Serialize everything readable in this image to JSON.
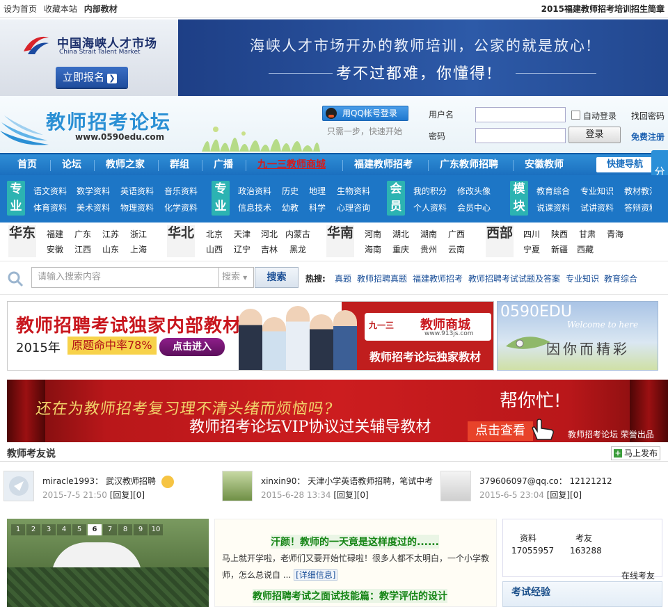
{
  "topbar": {
    "links": [
      "设为首页",
      "收藏本站"
    ],
    "bold_link": "内部教材",
    "right_link": "2015福建教师招考培训招生简章"
  },
  "banner": {
    "logo_cn": "中国海峡人才市场",
    "logo_en": "China Strait Talent Market",
    "register_btn": "立即报名",
    "slogan1": "海峡人才市场开办的教师培训，公家的就是放心!",
    "slogan2": "考不过都难，你懂得!"
  },
  "header": {
    "site_title": "教师招考论坛",
    "site_url": "www.0590edu.com",
    "qq_btn": "用QQ帐号登录",
    "qq_hint": "只需一步，快速开始",
    "username_label": "用户名",
    "password_label": "密码",
    "auto_login": "自动登录",
    "login_btn": "登录",
    "find_pwd": "找回密码",
    "register": "免费注册"
  },
  "nav": {
    "items": [
      "首页",
      "论坛",
      "教师之家",
      "群组",
      "广播",
      "九一三教师商城",
      "福建教师招考",
      "广东教师招聘",
      "安徽教师"
    ],
    "quick": "快捷导航",
    "share": "分享"
  },
  "categories": [
    {
      "badge": "专业",
      "links": [
        "语文资料",
        "数学资料",
        "英语资料",
        "音乐资料",
        "体育资料",
        "美术资料",
        "物理资料",
        "化学资料"
      ]
    },
    {
      "badge": "专业",
      "links": [
        "政治资料",
        "历史",
        "地理",
        "生物资料",
        "信息技术",
        "幼教",
        "科学",
        "心理咨询"
      ]
    },
    {
      "badge": "会员",
      "links": [
        "我的积分",
        "修改头像",
        "个人资料",
        "会员中心"
      ]
    },
    {
      "badge": "模块",
      "links": [
        "教育综合",
        "专业知识",
        "教材教法",
        "说课资料",
        "试讲资料",
        "答辩资料"
      ]
    }
  ],
  "regions": [
    {
      "badge": "华东",
      "links": [
        "福建",
        "广东",
        "江苏",
        "浙江",
        "安徽",
        "江西",
        "山东",
        "上海"
      ]
    },
    {
      "badge": "华北",
      "links": [
        "北京",
        "天津",
        "河北",
        "内蒙古",
        "山西",
        "辽宁",
        "吉林",
        "黑龙"
      ]
    },
    {
      "badge": "华南",
      "links": [
        "河南",
        "湖北",
        "湖南",
        "广西",
        "海南",
        "重庆",
        "贵州",
        "云南"
      ]
    },
    {
      "badge": "西部",
      "links": [
        "四川",
        "陕西",
        "甘肃",
        "青海",
        "宁夏",
        "新疆",
        "西藏"
      ]
    }
  ],
  "search": {
    "placeholder": "请输入搜索内容",
    "select": "搜索",
    "button": "搜索",
    "hot_label": "热搜:",
    "hot": [
      "真题",
      "教师招聘真题",
      "福建教师招考",
      "教师招聘考试试题及答案",
      "专业知识",
      "教育综合"
    ]
  },
  "ad1": {
    "title": "教师招聘考试独家内部教材",
    "year": "2015年",
    "rate": "原题命中率78%",
    "btn": "点击进入",
    "shop_num": "九一三",
    "shop_name": "教师商城",
    "shop_url": "www.913js.com",
    "bottom": "教师招考论坛独家教材"
  },
  "ad2": {
    "title": "0590EDU",
    "script": "Welcome to here",
    "text": "因你而精彩"
  },
  "ad3": {
    "line1": "还在为教师招考复习理不清头绪而烦恼吗?",
    "line2": "教师招考论坛VIP协议过关辅导教材",
    "line3": "帮你忙!",
    "btn": "点击查看",
    "brand": "教师招考论坛 荣誉出品"
  },
  "friends": {
    "title": "教师考友说",
    "post_btn": "马上发布",
    "items": [
      {
        "name": "miracle1993",
        "text": "武汉教师招聘",
        "time": "2015-7-5 21:50",
        "reply": "[回复]",
        "count": "[0]"
      },
      {
        "name": "xinxin90",
        "text": "天津小学英语教师招聘，笔试中考",
        "time": "2015-6-28 13:34",
        "reply": "[回复]",
        "count": "[0]"
      },
      {
        "name": "379606097@qq.co",
        "text": "12121212",
        "time": "2015-6-5 23:04",
        "reply": "[回复]",
        "count": "[0]"
      }
    ]
  },
  "slider": {
    "pages": [
      "1",
      "2",
      "3",
      "4",
      "5",
      "6",
      "7",
      "8",
      "9",
      "10"
    ],
    "active_index": 6
  },
  "news": [
    {
      "title": "汗颜！教师的一天竟是这样度过的......",
      "body": "马上就开学啦，老师们又要开始忙碌啦！很多人都不太明白，一个小学教师，怎么总说自 ...",
      "detail": "[详细信息]"
    },
    {
      "title": "教师招聘考试之面试技能篇：教学评估的设计"
    }
  ],
  "stats": {
    "label1": "资料",
    "value1": "17055957",
    "label2": "考友",
    "value2": "163288",
    "online": "在线考友"
  },
  "exp": {
    "title": "考试经验"
  },
  "colors": {
    "nav": "#1b6fbf",
    "badge": "#2cb3b2",
    "hot_nav": "#d41c1c",
    "ad_red": "#c8161d"
  }
}
